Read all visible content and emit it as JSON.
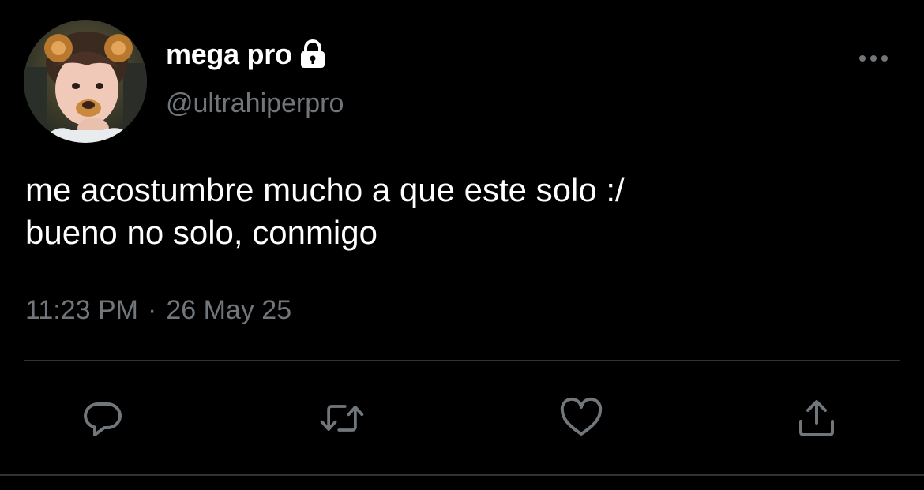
{
  "tweet": {
    "display_name": "mega pro",
    "handle": "@ultrahiperpro",
    "protected_icon": "lock-icon",
    "avatar_icon": "avatar-photo",
    "more_icon": "more-horizontal-icon",
    "text": "me acostumbre mucho a que este solo :/\nbueno no solo, conmigo",
    "time": "11:23 PM",
    "separator": "·",
    "date": "26 May 25"
  },
  "actions": {
    "reply_icon": "reply-icon",
    "retweet_icon": "retweet-icon",
    "like_icon": "heart-icon",
    "share_icon": "share-icon"
  },
  "colors": {
    "background": "#000000",
    "primary_text": "#ffffff",
    "secondary_text": "#71767b",
    "divider": "#2f3336",
    "icon": "#71767b"
  }
}
